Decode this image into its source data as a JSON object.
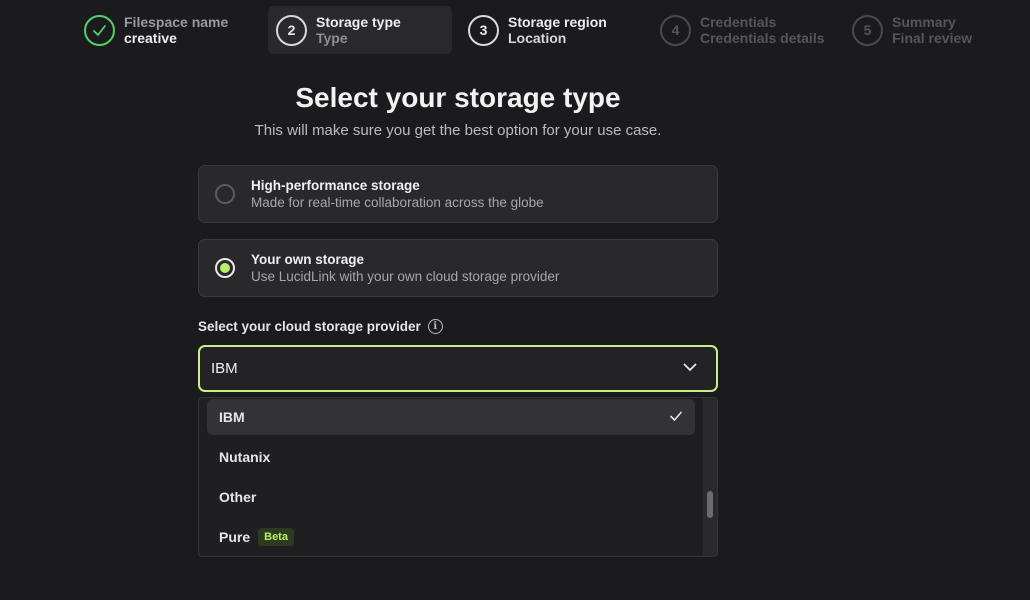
{
  "stepper": {
    "steps": [
      {
        "number": "1",
        "title": "Filespace name",
        "subtitle": "creative",
        "state": "done"
      },
      {
        "number": "2",
        "title": "Storage type",
        "subtitle": "Type",
        "state": "active"
      },
      {
        "number": "3",
        "title": "Storage region",
        "subtitle": "Location",
        "state": "current-next"
      },
      {
        "number": "4",
        "title": "Credentials",
        "subtitle": "Credentials details",
        "state": "pending"
      },
      {
        "number": "5",
        "title": "Summary",
        "subtitle": "Final review",
        "state": "pending"
      }
    ]
  },
  "page": {
    "title": "Select your storage type",
    "subtitle": "This will make sure you get the best option for your use case."
  },
  "options": [
    {
      "title": "High-performance storage",
      "description": "Made for real-time collaboration across the globe",
      "selected": false
    },
    {
      "title": "Your own storage",
      "description": "Use LucidLink with your own cloud storage provider",
      "selected": true
    }
  ],
  "provider": {
    "label": "Select your cloud storage provider",
    "info_icon": "i",
    "selected_value": "IBM",
    "items": [
      {
        "label": "IBM",
        "selected": true,
        "badge": ""
      },
      {
        "label": "Nutanix",
        "selected": false,
        "badge": ""
      },
      {
        "label": "Other",
        "selected": false,
        "badge": ""
      },
      {
        "label": "Pure",
        "selected": false,
        "badge": "Beta"
      }
    ]
  },
  "colors": {
    "accent": "#b6f06a",
    "done": "#4fd06a",
    "background": "#1b1b1d"
  }
}
